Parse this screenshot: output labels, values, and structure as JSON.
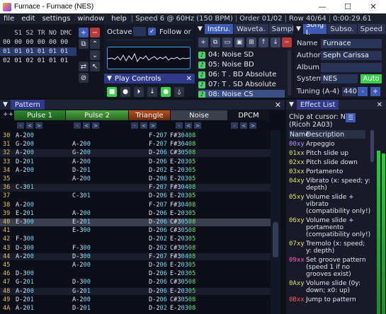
{
  "window": {
    "title": "Furnace - Furnace (NES)",
    "min": "—",
    "max": "☐",
    "close": "✕"
  },
  "menu": {
    "items": [
      "file",
      "edit",
      "settings",
      "window",
      "help"
    ],
    "sep": "|",
    "status": [
      "Speed 6 @ 60Hz (150 BPM)",
      "Order 01/02",
      "Row 40/64",
      "0:00:29.61"
    ]
  },
  "orders": {
    "header": "   S1 S2 TR NO DMC",
    "rows": [
      {
        "num": "00",
        "vals": "00 00 00 00 00"
      },
      {
        "num": "01",
        "vals": "01 01 01 01 01"
      },
      {
        "num": "02",
        "vals": "01 02 01 01 01"
      }
    ]
  },
  "song_controls": {
    "octave_label": "Octave",
    "octave_value": "",
    "follow_label": "Follow or"
  },
  "play_controls": {
    "title": "Play Controls",
    "close": "✕"
  },
  "instruments": {
    "tabs": [
      "Instru.",
      "Waveta.",
      "Sampl."
    ],
    "close": "✕",
    "items": [
      {
        "label": "04: Noise SD",
        "selected": false
      },
      {
        "label": "05: Noise BD",
        "selected": false
      },
      {
        "label": "06: T . BD Absolute",
        "selected": false
      },
      {
        "label": "07: T . SD Absolute",
        "selected": false
      },
      {
        "label": "08: Noise CS",
        "selected": true
      }
    ]
  },
  "song_info": {
    "tabs": [
      "Song I.",
      "Subso.",
      "Speed"
    ],
    "name_label": "Name",
    "name_value": "Furnace",
    "author_label": "Author",
    "author_value": "Seph Carissa",
    "album_label": "Album",
    "album_value": "",
    "system_label": "System",
    "system_value": "NES",
    "auto_label": "Auto",
    "tuning_label": "Tuning (A-4)",
    "tuning_value": "440",
    "minus": "-",
    "plus": "+"
  },
  "pattern": {
    "title": "Pattern",
    "close": "✕",
    "corner": "++",
    "channels": [
      {
        "name": "Pulse 1",
        "color": "#2d8a2d"
      },
      {
        "name": "Pulse 2",
        "color": "#4ea83e"
      },
      {
        "name": "Triangle",
        "color": "#b8501e"
      },
      {
        "name": "Noise",
        "color": "#3c3f4c"
      },
      {
        "name": "DPCM",
        "color": "#121420"
      }
    ],
    "ctl_minus": "-",
    "ctl_lt": "<",
    "ctl_gt": ">",
    "rows": [
      {
        "n": "30",
        "c": [
          "A-200",
          "",
          "F-207",
          "F#30408",
          ""
        ]
      },
      {
        "n": "31",
        "c": [
          "G-200",
          "A-200",
          "F-207",
          "F#30408",
          ""
        ]
      },
      {
        "n": "32",
        "c": [
          "A-200",
          "G-200",
          "D-206",
          "C#30508",
          ""
        ]
      },
      {
        "n": "33",
        "c": [
          "D-201",
          "A-200",
          "D-206",
          "E-20305",
          ""
        ]
      },
      {
        "n": "34",
        "c": [
          "A-200",
          "D-201",
          "D-202",
          "E-20305",
          ""
        ]
      },
      {
        "n": "35",
        "c": [
          "",
          "A-200",
          "D-206",
          "E-20305",
          ""
        ]
      },
      {
        "n": "36",
        "c": [
          "C-301",
          "",
          "F-207",
          "F#30408",
          ""
        ]
      },
      {
        "n": "37",
        "c": [
          "",
          "C-301",
          "D-206",
          "E-20305",
          ""
        ]
      },
      {
        "n": "38",
        "c": [
          "A-200",
          "",
          "F-207",
          "F#30408",
          ""
        ]
      },
      {
        "n": "39",
        "c": [
          "E-201",
          "A-200",
          "D-206",
          "E-20305",
          ""
        ]
      },
      {
        "n": "40",
        "c": [
          "E-300",
          "E-201",
          "D-206",
          "C#30508",
          ""
        ]
      },
      {
        "n": "41",
        "c": [
          "",
          "E-300",
          "D-206",
          "C#30508",
          ""
        ]
      },
      {
        "n": "42",
        "c": [
          "F-300",
          "",
          "D-202",
          "E-20305",
          ""
        ]
      },
      {
        "n": "43",
        "c": [
          "D-300",
          "F-300",
          "D-202",
          "C#30508",
          ""
        ]
      },
      {
        "n": "44",
        "c": [
          "A-200",
          "D-300",
          "F-207",
          "F#30408",
          ""
        ]
      },
      {
        "n": "45",
        "c": [
          "",
          "A-200",
          "D-206",
          "E-20305",
          ""
        ]
      },
      {
        "n": "46",
        "c": [
          "D-300",
          "",
          "D-206",
          "E-20305",
          ""
        ]
      },
      {
        "n": "47",
        "c": [
          "G-201",
          "D-300",
          "D-206",
          "C#30508",
          ""
        ]
      },
      {
        "n": "48",
        "c": [
          "A-200",
          "G-201",
          "D-206",
          "E-20305",
          ""
        ]
      },
      {
        "n": "49",
        "c": [
          "D-201",
          "A-200",
          "D-206",
          "C#30508",
          ""
        ]
      },
      {
        "n": "4A",
        "c": [
          "A-201",
          "D-201",
          "D-202",
          "E-20308",
          ""
        ]
      }
    ]
  },
  "effect_list": {
    "title": "Effect List",
    "close": "✕",
    "chip_line1": "Chip at cursor: NES",
    "chip_line2": "(Ricoh 2A03)",
    "col_name": "Name",
    "col_desc": "Description",
    "items": [
      {
        "code": "00xy",
        "color": "#c08cff",
        "desc": "Arpeggio"
      },
      {
        "code": "01xx",
        "color": "#e8e06a",
        "desc": "Pitch slide up"
      },
      {
        "code": "02xx",
        "color": "#e8e06a",
        "desc": "Pitch slide down"
      },
      {
        "code": "03xx",
        "color": "#e8e06a",
        "desc": "Portamento"
      },
      {
        "code": "04xy",
        "color": "#e8e06a",
        "desc": "Vibrato (x: speed; y: depth)"
      },
      {
        "code": "05xy",
        "color": "#e8e06a",
        "desc": "Volume slide + vibrato (compatibility only!)"
      },
      {
        "code": "06xy",
        "color": "#e8e06a",
        "desc": "Volume slide + portamento (compatibility only!)"
      },
      {
        "code": "07xy",
        "color": "#e8e06a",
        "desc": "Tremolo (x: speed; y: depth)"
      },
      {
        "code": "09xx",
        "color": "#ff5ad0",
        "desc": "Set groove pattern (speed 1 if no grooves exist)"
      },
      {
        "code": "0Axy",
        "color": "#e8e06a",
        "desc": "Volume slide (0y: down; x0: up)"
      },
      {
        "code": "0Bxx",
        "color": "#ff5a5a",
        "desc": "Jump to pattern"
      }
    ]
  }
}
